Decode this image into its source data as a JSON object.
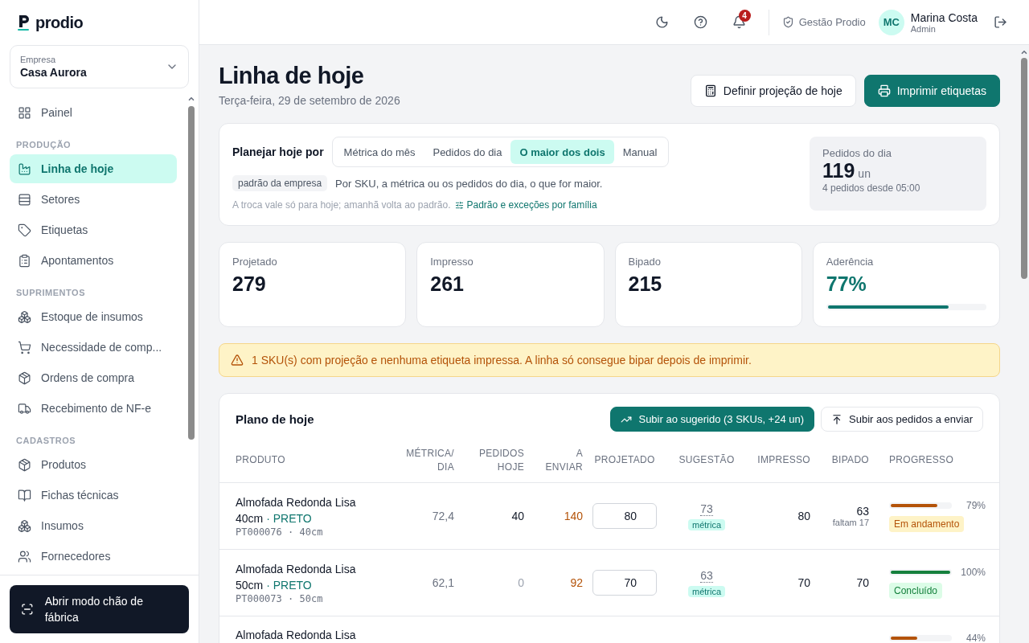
{
  "brand": {
    "name": "prodio"
  },
  "company": {
    "label": "Empresa",
    "value": "Casa Aurora"
  },
  "sidebar": {
    "sections": [
      {
        "items": [
          {
            "label": "Painel",
            "selected": false
          }
        ]
      },
      {
        "title": "PRODUÇÃO",
        "items": [
          {
            "label": "Linha de hoje",
            "selected": true
          },
          {
            "label": "Setores",
            "selected": false
          },
          {
            "label": "Etiquetas",
            "selected": false
          },
          {
            "label": "Apontamentos",
            "selected": false
          }
        ]
      },
      {
        "title": "SUPRIMENTOS",
        "items": [
          {
            "label": "Estoque de insumos",
            "selected": false
          },
          {
            "label": "Necessidade de comp...",
            "selected": false
          },
          {
            "label": "Ordens de compra",
            "selected": false
          },
          {
            "label": "Recebimento de NF-e",
            "selected": false
          }
        ]
      },
      {
        "title": "CADASTROS",
        "items": [
          {
            "label": "Produtos",
            "selected": false
          },
          {
            "label": "Fichas técnicas",
            "selected": false
          },
          {
            "label": "Insumos",
            "selected": false
          },
          {
            "label": "Fornecedores",
            "selected": false
          }
        ]
      }
    ],
    "footer_button": "Abrir modo chão de fábrica"
  },
  "header": {
    "notifications": "4",
    "workspace": "Gestão Prodio",
    "user": {
      "initials": "MC",
      "name": "Marina Costa",
      "role": "Admin"
    }
  },
  "page": {
    "title": "Linha de hoje",
    "date": "Terça-feira, 29 de setembro de 2026",
    "actions": [
      {
        "label": "Definir projeção de hoje",
        "kind": "secondary"
      },
      {
        "label": "Imprimir etiquetas",
        "kind": "primary"
      }
    ]
  },
  "plan": {
    "label": "Planejar hoje por",
    "modes": [
      {
        "label": "Métrica do mês",
        "selected": false
      },
      {
        "label": "Pedidos do dia",
        "selected": false
      },
      {
        "label": "O maior dos dois",
        "selected": true
      },
      {
        "label": "Manual",
        "selected": false
      }
    ],
    "tag": "padrão da empresa",
    "description": "Por SKU, a métrica ou os pedidos do dia, o que for maior.",
    "note": "A troca vale só para hoje; amanhã volta ao padrão.",
    "link": "Padrão e exceções por família",
    "orders": {
      "label": "Pedidos do dia",
      "value": "119",
      "unit": "un",
      "caption": "4 pedidos desde 05:00"
    }
  },
  "stats": [
    {
      "label": "Projetado",
      "value": "279",
      "kind": "plain"
    },
    {
      "label": "Impresso",
      "value": "261",
      "kind": "plain"
    },
    {
      "label": "Bipado",
      "value": "215",
      "kind": "plain"
    },
    {
      "label": "Aderência",
      "value": "77%",
      "kind": "meter",
      "level": 0.77
    }
  ],
  "alert": "1 SKU(s) com projeção e nenhuma etiqueta impressa. A linha só consegue bipar depois de imprimir.",
  "table": {
    "title": "Plano de hoje",
    "actions": [
      {
        "label": "Subir ao sugerido (3 SKUs, +24 un)",
        "kind": "primary"
      },
      {
        "label": "Subir aos pedidos a enviar",
        "kind": "secondary"
      }
    ],
    "columns": [
      "PRODUTO",
      "MÉTRICA/ DIA",
      "PEDIDOS HOJE",
      "A ENVIAR",
      "PROJETADO",
      "SUGESTÃO",
      "IMPRESSO",
      "BIPADO",
      "PROGRESSO"
    ],
    "rows": [
      {
        "name": "Almofada Redonda Lisa 40cm",
        "variant": "· PRETO",
        "sku": "PT000076 · 40cm",
        "metric": "72,4",
        "orders": "40",
        "to_send": "140",
        "projected": "80",
        "suggestion": "73",
        "suggestion_tag": "métrica",
        "printed": "80",
        "scanned": "63",
        "remaining": "faltam 17",
        "level": 0.79,
        "percent": "79%",
        "status": "Em andamento",
        "kind": "progress"
      },
      {
        "name": "Almofada Redonda Lisa 50cm",
        "variant": "· PRETO",
        "sku": "PT000073 · 50cm",
        "metric": "62,1",
        "orders": "0",
        "to_send": "92",
        "projected": "70",
        "suggestion": "63",
        "suggestion_tag": "métrica",
        "printed": "70",
        "scanned": "70",
        "level": 1,
        "percent": "100%",
        "status": "Concluído",
        "kind": "done"
      },
      {
        "name": "Almofada Redonda Lisa",
        "level": 0.44,
        "percent": "44%",
        "kind": "progress"
      }
    ]
  }
}
